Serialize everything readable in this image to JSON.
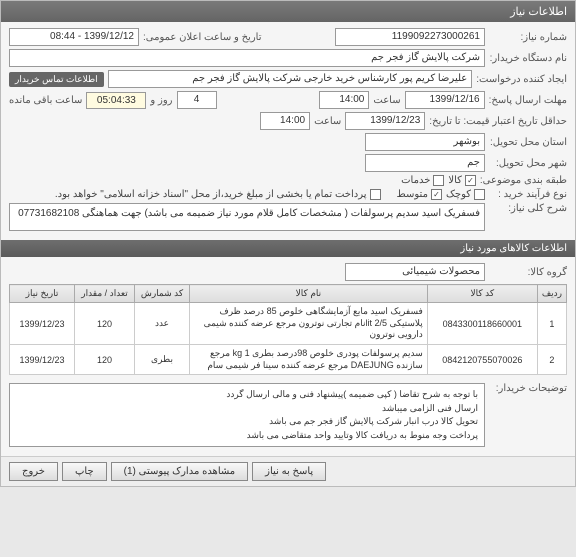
{
  "header": {
    "title": "اطلاعات نیاز"
  },
  "form": {
    "need_no_label": "شماره نیاز:",
    "need_no": "1199092273000261",
    "announce_label": "تاریخ و ساعت اعلان عمومی:",
    "announce_value": "1399/12/12 - 08:44",
    "buyer_org_label": "نام دستگاه خریدار:",
    "buyer_org": "شرکت پالایش گاز فجر جم",
    "creator_label": "ایجاد کننده درخواست:",
    "creator": "علیرضا کریم پور کارشناس خرید خارجی شرکت پالایش گاز فجر جم",
    "contact_badge": "اطلاعات تماس خریدار",
    "deadline_label": "مهلت ارسال پاسخ:",
    "deadline_date": "1399/12/16",
    "time_label": "ساعت",
    "deadline_time": "14:00",
    "days": "4",
    "days_label": "روز و",
    "timer": "05:04:33",
    "timer_label": "ساعت باقی مانده",
    "validity_label": "حداقل تاریخ اعتبار قیمت: تا تاریخ:",
    "validity_date": "1399/12/23",
    "validity_time": "14:00",
    "province_label": "استان محل تحویل:",
    "province": "بوشهر",
    "city_label": "شهر محل تحویل:",
    "city": "جم",
    "budget_label": "طبقه بندی موضوعی:",
    "chk_kala": "کالا",
    "chk_khadamat": "خدمات",
    "process_label": "نوع فرآیند خرید :",
    "chk_small": "کوچک",
    "chk_medium": "متوسط",
    "process_note": "پرداخت تمام یا بخشی از مبلغ خرید،از محل \"اسناد خزانه اسلامی\" خواهد بود.",
    "subject_label": "شرح کلی نیاز:",
    "subject": "فسفریک اسید سدیم پرسولفات (  مشخصات کامل قلام مورد نیاز  ضمیمه می باشد) جهت هماهنگی 07731682108"
  },
  "items_header": "اطلاعات کالاهای مورد نیاز",
  "group_label": "گروه کالا:",
  "group_value": "محصولات شیمیائی",
  "table": {
    "cols": [
      "ردیف",
      "کد کالا",
      "نام کالا",
      "کد شمارش",
      "تعداد / مقدار",
      "تاریخ نیاز"
    ],
    "rows": [
      {
        "idx": "1",
        "code": "0843300118660001",
        "name": "فسفریک اسید مایع آزمایشگاهی خلوص 85 درصد ظرف پلاستیکی lit 2/5نام تجارتی نوترون مرجع عرضه کننده شیمی دارویی نوترون",
        "unit": "عدد",
        "qty": "120",
        "date": "1399/12/23"
      },
      {
        "idx": "2",
        "code": "0842120755070026",
        "name": "سدیم پرسولفات پودری خلوص 98درصد بطری kg 1 مرجع سازنده DAEJUNG مرجع عرضه کننده سینا فر شیمی سام",
        "unit": "بطری",
        "qty": "120",
        "date": "1399/12/23"
      }
    ]
  },
  "notes_label": "توضیحات خریدار:",
  "notes": "با توجه به شرح تقاضا ( کپی ضمیمه )پیشنهاد فنی و مالی ارسال گردد\nارسال فنی الزامی میباشد\nتحویل کالا درب انبار شرکت  پالایش گاز فجر جم می باشد\nپرداخت وجه منوط به دریافت کالا وتایید واحد متقاضی می باشد",
  "buttons": {
    "answer": "پاسخ به نیاز",
    "attachments": "مشاهده مدارک پیوستی (1)",
    "print": "چاپ",
    "exit": "خروج"
  }
}
